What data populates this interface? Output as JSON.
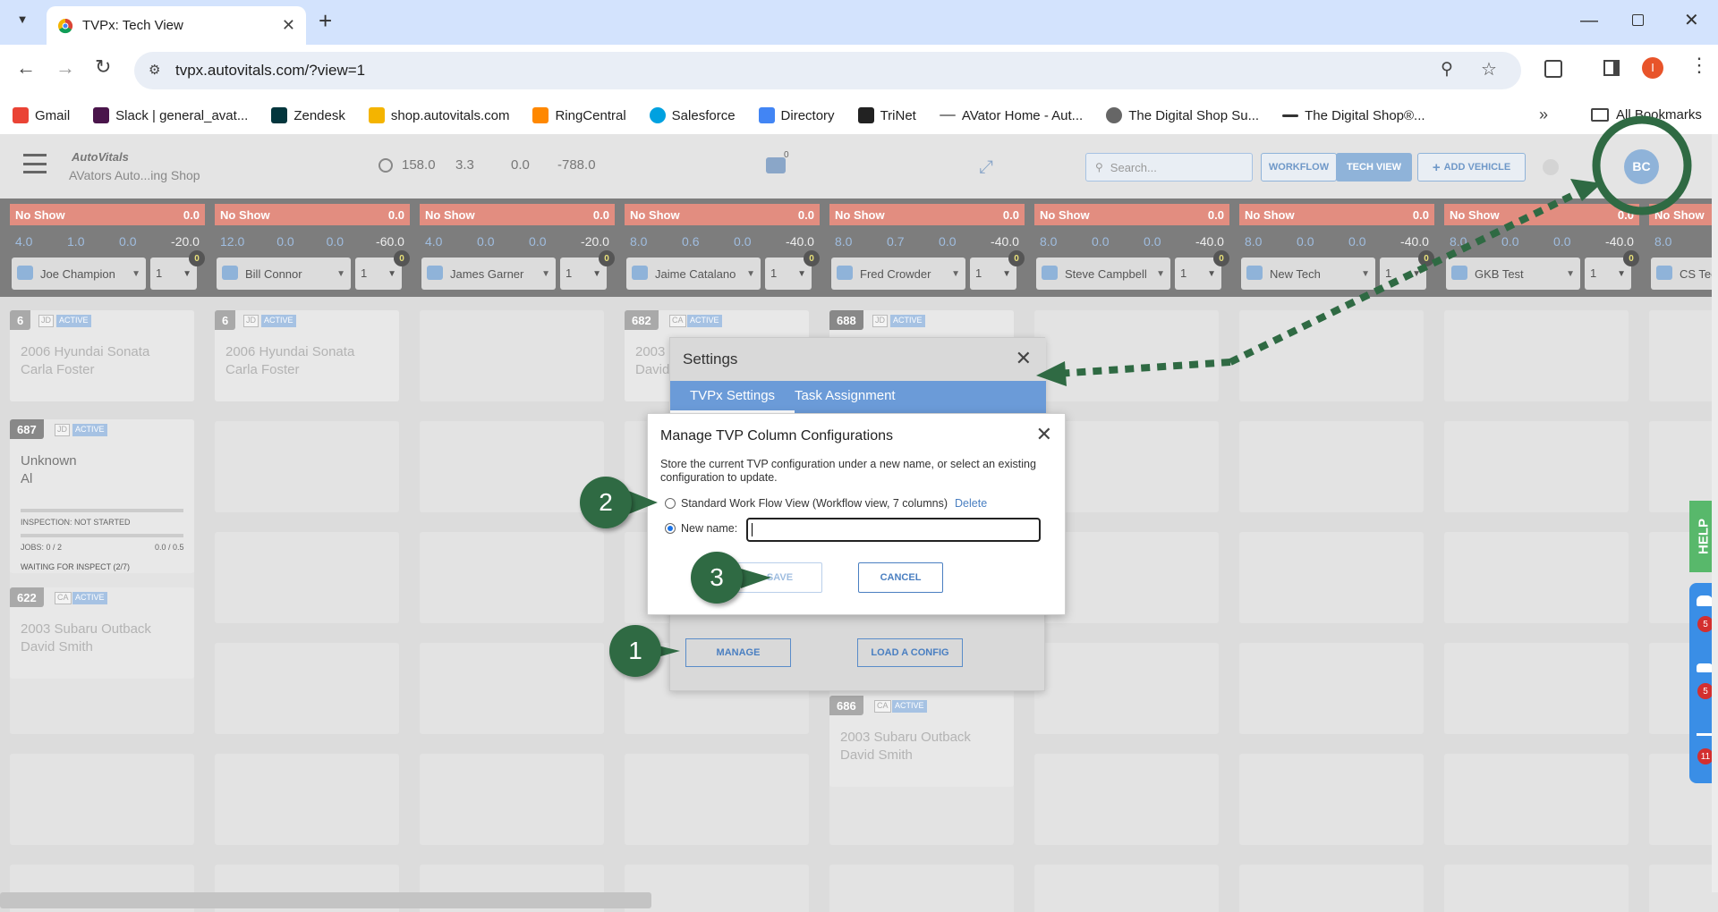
{
  "browser": {
    "tab_title": "TVPx: Tech View",
    "url": "tvpx.autovitals.com/?view=1",
    "new_tab": "+",
    "bookmarks": [
      "Gmail",
      "Slack | general_avat...",
      "Zendesk",
      "shop.autovitals.com",
      "RingCentral",
      "Salesforce",
      "Directory",
      "TriNet",
      "AVator Home - Aut...",
      "The Digital Shop Su...",
      "The Digital Shop®..."
    ],
    "all_bookmarks": "All Bookmarks",
    "profile_initial": "I"
  },
  "app": {
    "logo": "AutoVitals",
    "shop_name": "AVators Auto...ing Shop",
    "stats": [
      "158.0",
      "3.3",
      "0.0",
      "-788.0"
    ],
    "chat_count": "0",
    "search_placeholder": "Search...",
    "workflow_btn": "WORKFLOW",
    "techview_btn": "TECH VIEW",
    "add_vehicle_btn": "ADD VEHICLE",
    "avatar": "BC"
  },
  "columns": [
    {
      "status": "No Show",
      "hours": "0.0",
      "nums": [
        "4.0",
        "1.0",
        "0.0",
        "-20.0"
      ],
      "tech": "Joe Champion",
      "count": "1",
      "badge": "0"
    },
    {
      "status": "No Show",
      "hours": "0.0",
      "nums": [
        "12.0",
        "0.0",
        "0.0",
        "-60.0"
      ],
      "tech": "Bill Connor",
      "count": "1",
      "badge": "0"
    },
    {
      "status": "No Show",
      "hours": "0.0",
      "nums": [
        "4.0",
        "0.0",
        "0.0",
        "-20.0"
      ],
      "tech": "James Garner",
      "count": "1",
      "badge": "0"
    },
    {
      "status": "No Show",
      "hours": "0.0",
      "nums": [
        "8.0",
        "0.6",
        "0.0",
        "-40.0"
      ],
      "tech": "Jaime Catalano",
      "count": "1",
      "badge": "0"
    },
    {
      "status": "No Show",
      "hours": "0.0",
      "nums": [
        "8.0",
        "0.7",
        "0.0",
        "-40.0"
      ],
      "tech": "Fred Crowder",
      "count": "1",
      "badge": "0"
    },
    {
      "status": "No Show",
      "hours": "0.0",
      "nums": [
        "8.0",
        "0.0",
        "0.0",
        "-40.0"
      ],
      "tech": "Steve Campbell",
      "count": "1",
      "badge": "0"
    },
    {
      "status": "No Show",
      "hours": "0.0",
      "nums": [
        "8.0",
        "0.0",
        "0.0",
        "-40.0"
      ],
      "tech": "New Tech",
      "count": "1",
      "badge": "0"
    },
    {
      "status": "No Show",
      "hours": "0.0",
      "nums": [
        "8.0",
        "0.0",
        "0.0",
        "-40.0"
      ],
      "tech": "GKB Test",
      "count": "1",
      "badge": "0"
    },
    {
      "status": "No Show",
      "hours": "",
      "nums": [
        "8.0",
        "",
        "",
        ""
      ],
      "tech": "CS Tec",
      "count": "",
      "badge": ""
    }
  ],
  "cards": [
    {
      "num": "6",
      "tech": "JD",
      "state": "ACTIVE",
      "vehicle": "2006 Hyundai Sonata",
      "owner": "Carla Foster"
    },
    {
      "num": "6",
      "tech": "JD",
      "state": "ACTIVE",
      "vehicle": "2006 Hyundai Sonata",
      "owner": "Carla Foster"
    },
    {
      "num": "687",
      "tech": "JD",
      "state": "ACTIVE",
      "vehicle": "Unknown",
      "owner": "Al",
      "inspection": "INSPECTION: NOT STARTED",
      "jobs": "JOBS: 0 / 2",
      "time": "0.0 / 0.5",
      "waiting": "WAITING FOR INSPECT (2/7)"
    },
    {
      "num": "622",
      "tech": "CA",
      "state": "ACTIVE",
      "vehicle": "2003 Subaru Outback",
      "owner": "David Smith"
    },
    {
      "num": "682",
      "tech": "CA",
      "state": "ACTIVE",
      "vehicle": "2003",
      "owner": "David"
    },
    {
      "num": "688",
      "tech": "JD",
      "state": "ACTIVE",
      "vehicle": "",
      "owner": ""
    },
    {
      "num": "686",
      "tech": "CA",
      "state": "ACTIVE",
      "vehicle": "2003 Subaru Outback",
      "owner": "David Smith"
    }
  ],
  "settings": {
    "title": "Settings",
    "tabs": [
      "TVPx Settings",
      "Task Assignment"
    ],
    "manage_btn": "MANAGE",
    "load_btn": "LOAD A CONFIG"
  },
  "manage_dialog": {
    "title": "Manage TVP Column Configurations",
    "description": "Store the current TVP configuration under a new name, or select an existing configuration to update.",
    "option_existing": "Standard Work Flow View (Workflow view, 7 columns)",
    "delete_link": "Delete",
    "option_new": "New name:",
    "new_name_value": "",
    "save_btn": "SAVE",
    "cancel_btn": "CANCEL"
  },
  "callouts": [
    "1",
    "2",
    "3"
  ],
  "side_panel": {
    "help": "HELP",
    "badges": [
      "5",
      "5",
      "11"
    ]
  },
  "colors": {
    "accent": "#6b9bd8",
    "callout": "#2f6a43",
    "no_show": "#e28d80",
    "help": "#58b86b"
  }
}
